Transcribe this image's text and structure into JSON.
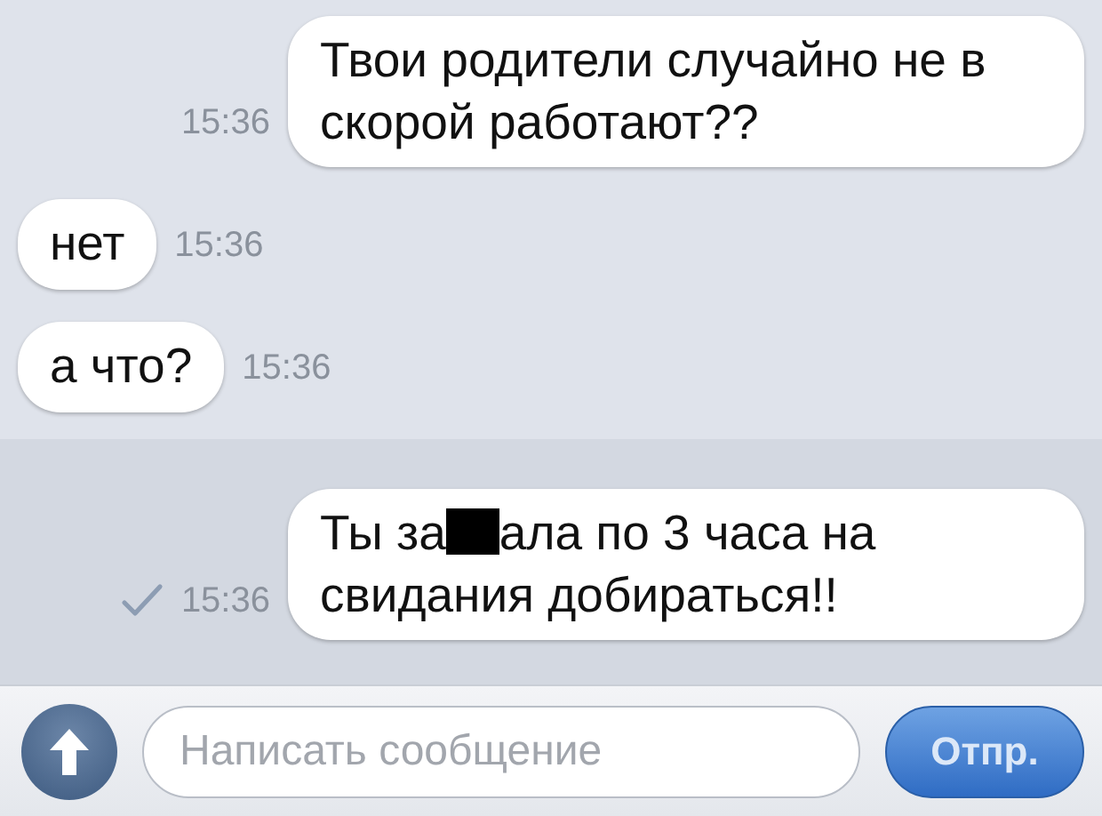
{
  "messages": [
    {
      "kind": "outgoing",
      "time": "15:36",
      "delivered": false,
      "highlighted": false,
      "parts": [
        {
          "kind": "text",
          "text": "Твои родители случайно не в скорой работают??"
        }
      ]
    },
    {
      "kind": "incoming",
      "time": "15:36",
      "highlighted": false,
      "parts": [
        {
          "kind": "text",
          "text": "нет"
        }
      ]
    },
    {
      "kind": "incoming",
      "time": "15:36",
      "highlighted": false,
      "parts": [
        {
          "kind": "text",
          "text": "а что?"
        }
      ]
    },
    {
      "kind": "outgoing",
      "time": "15:36",
      "delivered": true,
      "highlighted": true,
      "parts": [
        {
          "kind": "text",
          "text": "Ты за"
        },
        {
          "kind": "redaction"
        },
        {
          "kind": "text",
          "text": "ала по 3 часа на"
        },
        {
          "kind": "line",
          "text": "свидания добираться!!"
        }
      ]
    }
  ],
  "composer": {
    "placeholder": "Написать сообщение",
    "send_label": "Отпр."
  }
}
